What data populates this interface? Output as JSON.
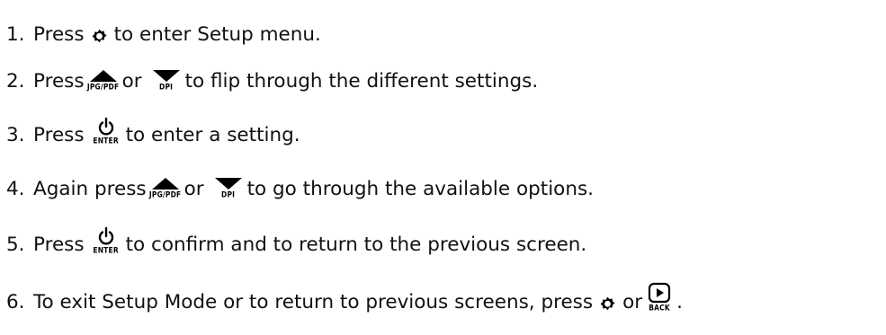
{
  "steps": [
    {
      "num": "1.",
      "t1": "Press",
      "t2": "to enter Setup menu."
    },
    {
      "num": "2.",
      "t1": "Press",
      "t2": "or",
      "t3": "to flip through the different settings."
    },
    {
      "num": "3.",
      "t1": "Press",
      "t2": "to enter a setting."
    },
    {
      "num": "4.",
      "t1": "Again press",
      "t2": "or",
      "t3": "to go through the available options."
    },
    {
      "num": "5.",
      "t1": "Press",
      "t2": "to confirm and to return to the previous screen."
    },
    {
      "num": "6.",
      "t1": "To exit Setup Mode or to return to previous screens, press",
      "t2": "or",
      "t3": "."
    }
  ],
  "keys": {
    "up_label": "JPG/PDF",
    "down_label": "DPI",
    "enter_label": "ENTER",
    "back_label": "BACK"
  },
  "icons": {
    "setup": "gear-icon",
    "up": "triangle-up-icon",
    "down": "triangle-down-icon",
    "enter": "power-icon",
    "back": "play-icon"
  },
  "colors": {
    "text": "#111111",
    "icon": "#000000"
  }
}
